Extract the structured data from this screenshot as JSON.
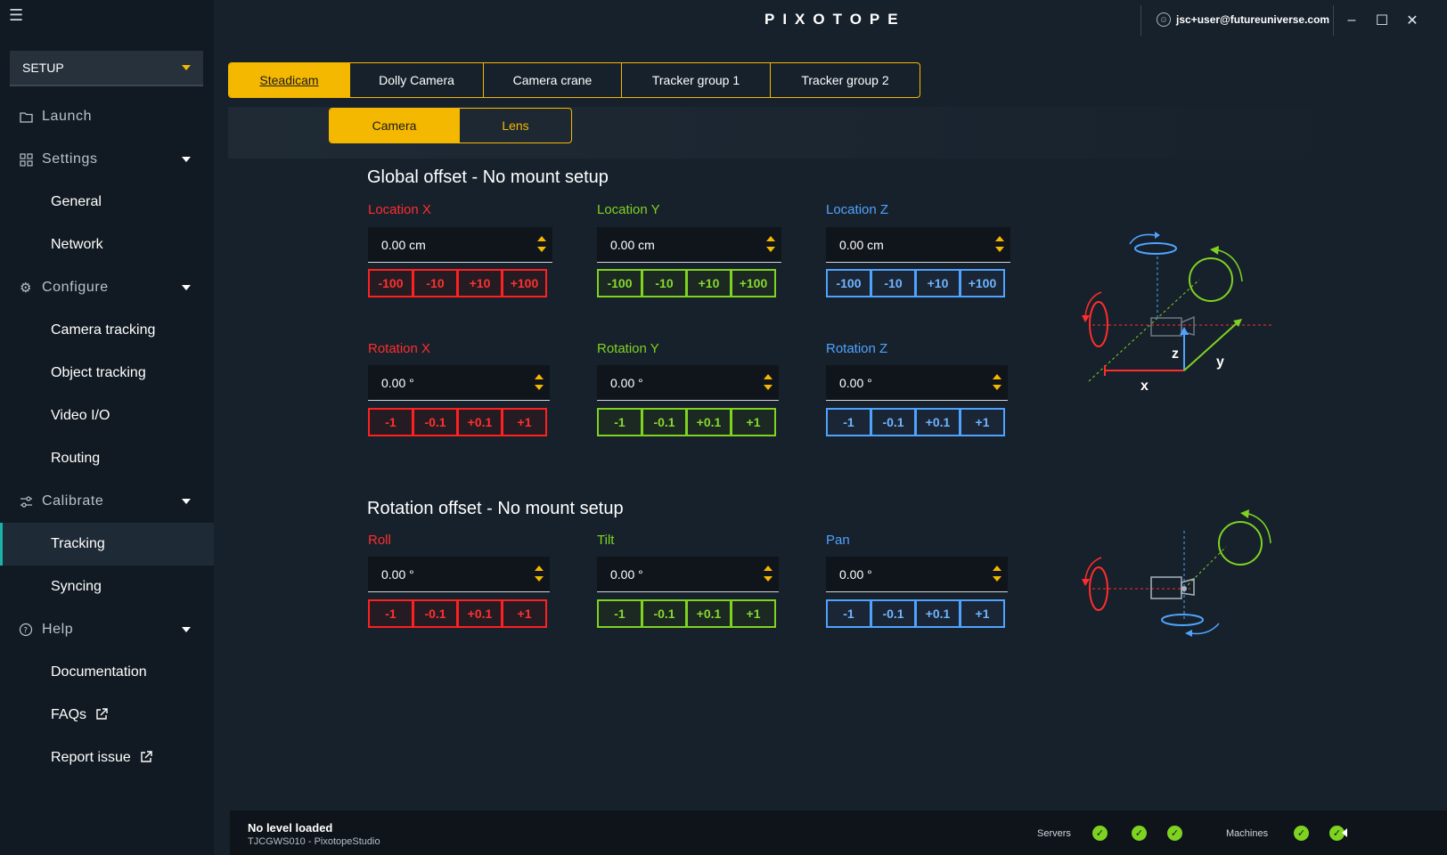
{
  "sidebar": {
    "mode": "SETUP",
    "groups": {
      "launch": "Launch",
      "settings": "Settings",
      "configure": "Configure",
      "calibrate": "Calibrate",
      "help": "Help"
    },
    "items": {
      "general": "General",
      "network": "Network",
      "camera_tracking": "Camera tracking",
      "object_tracking": "Object tracking",
      "video_io": "Video I/O",
      "routing": "Routing",
      "tracking": "Tracking",
      "syncing": "Syncing",
      "documentation": "Documentation",
      "faqs": "FAQs",
      "report_issue": "Report issue"
    }
  },
  "titlebar": {
    "logo": "PIXOTOPE",
    "user": "jsc+user@futureuniverse.com"
  },
  "tabs": [
    "Steadicam",
    "Dolly Camera",
    "Camera crane",
    "Tracker group 1",
    "Tracker group 2"
  ],
  "subtabs": [
    "Camera",
    "Lens"
  ],
  "global_offset": {
    "title": "Global offset - No mount setup",
    "location_x": {
      "label": "Location X",
      "value": "0.00 cm"
    },
    "location_y": {
      "label": "Location Y",
      "value": "0.00 cm"
    },
    "location_z": {
      "label": "Location Z",
      "value": "0.00 cm"
    },
    "rotation_x": {
      "label": "Rotation X",
      "value": "0.00 °"
    },
    "rotation_y": {
      "label": "Rotation Y",
      "value": "0.00 °"
    },
    "rotation_z": {
      "label": "Rotation Z",
      "value": "0.00 °"
    },
    "location_steps": [
      "-100",
      "-10",
      "+10",
      "+100"
    ],
    "rotation_steps": [
      "-1",
      "-0.1",
      "+0.1",
      "+1"
    ]
  },
  "rotation_offset": {
    "title": "Rotation offset - No mount setup",
    "roll": {
      "label": "Roll",
      "value": "0.00 °"
    },
    "tilt": {
      "label": "Tilt",
      "value": "0.00 °"
    },
    "pan": {
      "label": "Pan",
      "value": "0.00 °"
    },
    "steps": [
      "-1",
      "-0.1",
      "+0.1",
      "+1"
    ]
  },
  "diagram_labels": {
    "x": "x",
    "y": "y",
    "z": "z"
  },
  "status": {
    "title": "No level loaded",
    "subtitle": "TJCGWS010 - PixotopeStudio",
    "servers_label": "Servers",
    "machines_label": "Machines",
    "check": "✓"
  },
  "colors": {
    "accent": "#f5b800",
    "x_axis": "#ff2d2d",
    "y_axis": "#7ed321",
    "z_axis": "#4fa3ff",
    "active_indicator": "#19b3a6"
  }
}
